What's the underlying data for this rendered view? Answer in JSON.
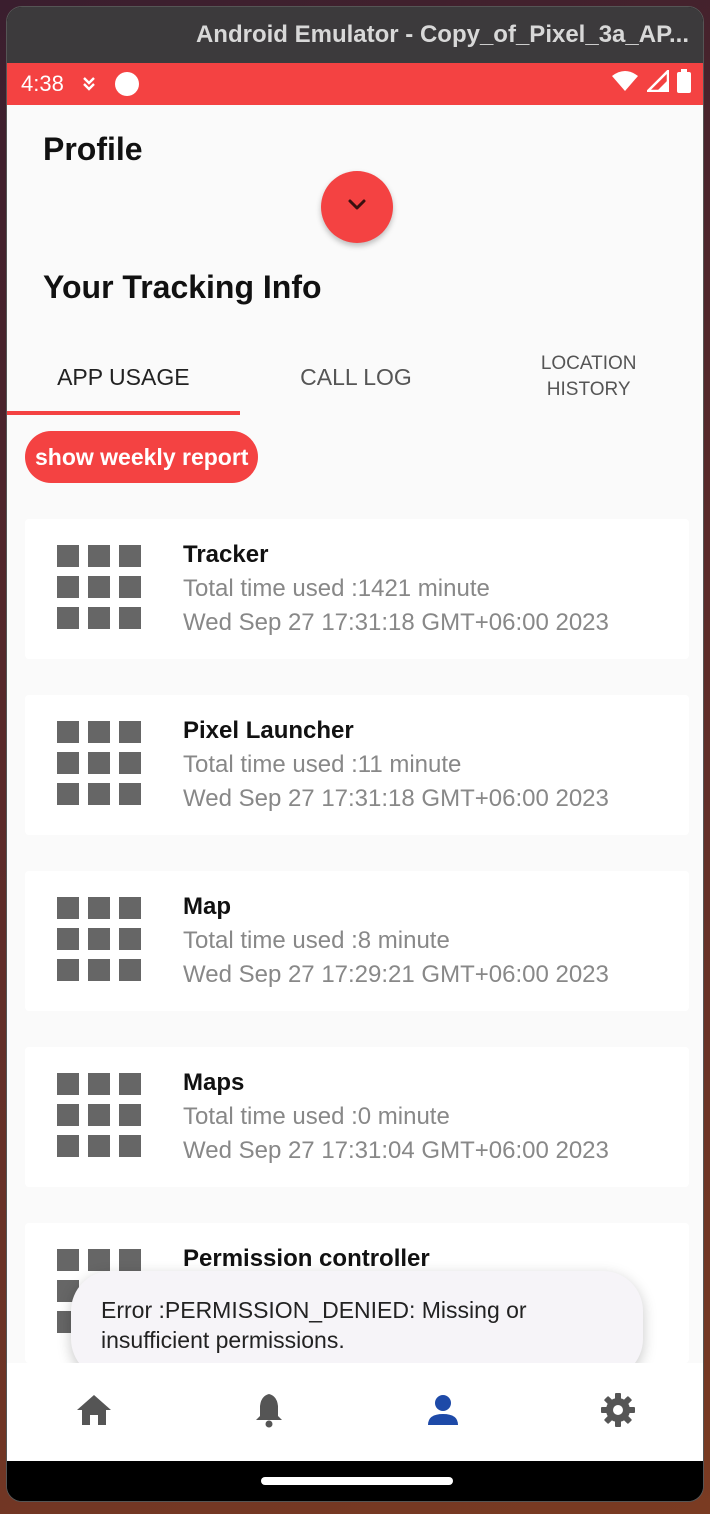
{
  "window": {
    "title": "Android Emulator - Copy_of_Pixel_3a_AP..."
  },
  "statusbar": {
    "time": "4:38"
  },
  "header": {
    "title": "Profile",
    "section_title": "Your Tracking Info"
  },
  "tabs": [
    {
      "label": "APP USAGE",
      "active": true
    },
    {
      "label": "CALL LOG",
      "active": false
    },
    {
      "label": "LOCATION\nHISTORY",
      "active": false
    }
  ],
  "weekly_button": {
    "label": "show weekly report"
  },
  "apps": [
    {
      "name": "Tracker",
      "usage": "Total time used :1421 minute",
      "timestamp": "Wed Sep 27 17:31:18 GMT+06:00 2023"
    },
    {
      "name": "Pixel Launcher",
      "usage": "Total time used :11 minute",
      "timestamp": "Wed Sep 27 17:31:18 GMT+06:00 2023"
    },
    {
      "name": "Map",
      "usage": "Total time used :8 minute",
      "timestamp": "Wed Sep 27 17:29:21 GMT+06:00 2023"
    },
    {
      "name": "Maps",
      "usage": "Total time used :0 minute",
      "timestamp": "Wed Sep 27 17:31:04 GMT+06:00 2023"
    },
    {
      "name": "Permission controller",
      "usage": "",
      "timestamp": ""
    }
  ],
  "toast": {
    "message": "Error :PERMISSION_DENIED: Missing or insufficient permissions."
  },
  "bottom_nav": {
    "items": [
      {
        "icon": "home-icon",
        "active": false
      },
      {
        "icon": "bell-icon",
        "active": false
      },
      {
        "icon": "person-icon",
        "active": true
      },
      {
        "icon": "gear-icon",
        "active": false
      }
    ]
  },
  "colors": {
    "accent": "#f44242",
    "nav_active": "#1e4aa8",
    "nav_inactive": "#555555"
  }
}
